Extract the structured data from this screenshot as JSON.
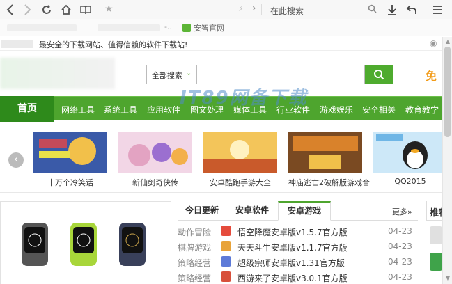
{
  "browser": {
    "address_placeholder": "",
    "search_placeholder": "在此搜索",
    "bookmark_dots": "-..",
    "bookmark_label": "安智官网"
  },
  "site": {
    "slogan": "最安全的下载网站、值得信赖的软件下载站!",
    "search_scope": "全部搜索",
    "search_value": "",
    "free_text": "免",
    "nav_home": "首页",
    "nav": [
      "网络工具",
      "系统工具",
      "应用软件",
      "图文处理",
      "媒体工具",
      "行业软件",
      "游戏娱乐",
      "安全相关",
      "教育教学"
    ],
    "games": [
      {
        "caption": "十万个冷笑话",
        "color": "#c44a5a"
      },
      {
        "caption": "新仙剑奇侠传",
        "color": "#e3a3c2"
      },
      {
        "caption": "安卓酷跑手游大全",
        "color": "#c95a2b"
      },
      {
        "caption": "神庙逃亡2破解版游戏合",
        "color": "#d9822b"
      },
      {
        "caption": "QQ2015",
        "color": "#6fb6e6"
      }
    ],
    "watermark": "IT89网备下载",
    "tabs": [
      "今日更新",
      "安卓软件",
      "安卓游戏"
    ],
    "active_tab": 2,
    "more": "更多»",
    "side_title": "推荐",
    "rows": [
      {
        "cat": "动作冒险",
        "title": "悟空降魔安卓版v1.5.7官方版",
        "date": "04-23",
        "icon": "#e54b3c"
      },
      {
        "cat": "棋牌游戏",
        "title": "天天斗牛安卓版v1.1.7官方版",
        "date": "04-23",
        "icon": "#e8a33a"
      },
      {
        "cat": "策略经营",
        "title": "超级宗师安卓版v1.31官方版",
        "date": "04-23",
        "icon": "#5d7ad8"
      },
      {
        "cat": "策略经营",
        "title": "西游来了安卓版v3.0.1官方版",
        "date": "04-23",
        "icon": "#d8503b"
      }
    ]
  },
  "colors": {
    "nav_green": "#4ea52e",
    "nav_home": "#2e8a1b",
    "orange": "#f29b18"
  }
}
